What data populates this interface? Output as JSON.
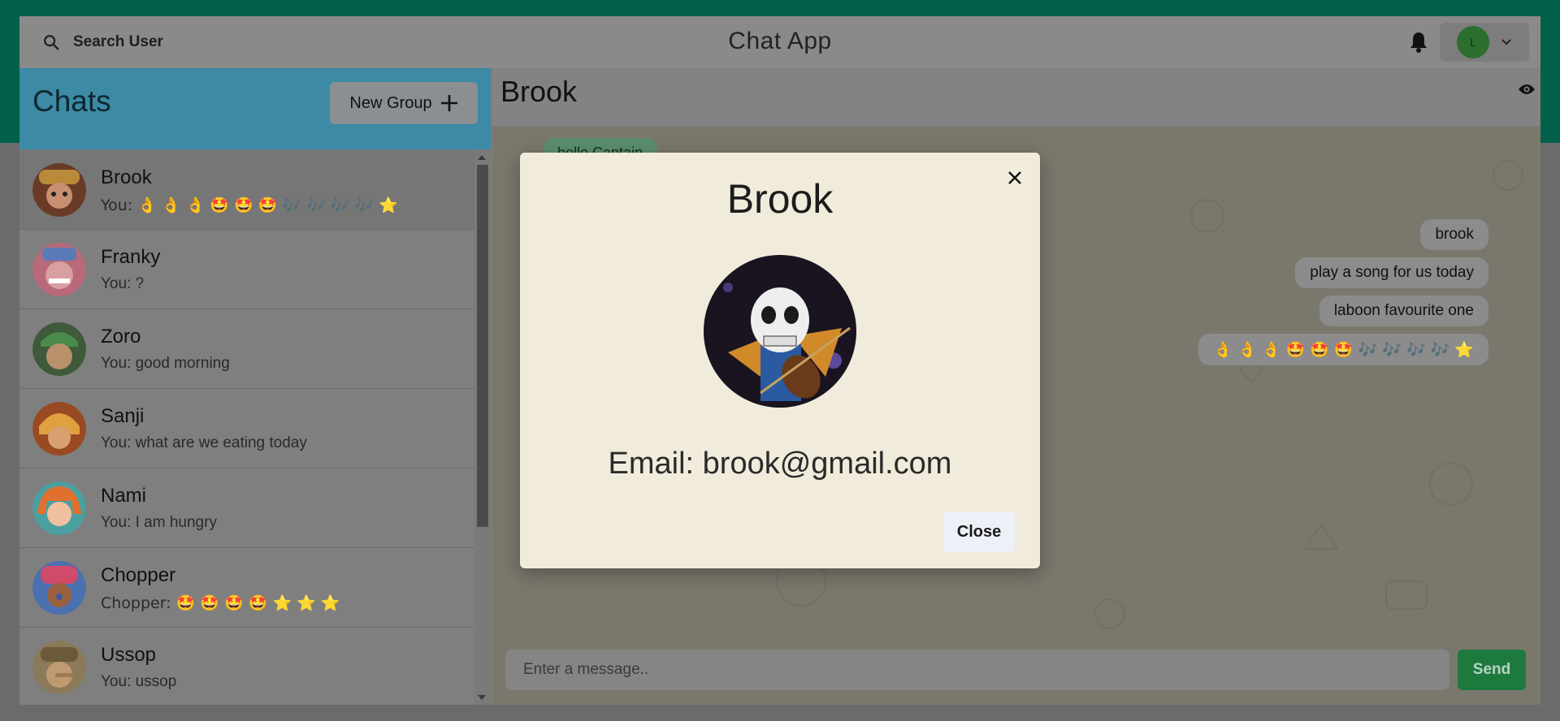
{
  "header": {
    "search_label": "Search User",
    "app_title": "Chat App",
    "user_initial": "L"
  },
  "sidebar": {
    "title": "Chats",
    "new_group_label": "New Group",
    "chats": [
      {
        "name": "Brook",
        "preview": "You: 👌 👌 👌 🤩 🤩 🤩 🎶 🎶 🎶 🎶 ⭐",
        "avatar_color": "#6a3a28",
        "active": true
      },
      {
        "name": "Franky",
        "preview": "You: ?",
        "avatar_color": "#b86a7a"
      },
      {
        "name": "Zoro",
        "preview": "You: good morning",
        "avatar_color": "#3e5a3a"
      },
      {
        "name": "Sanji",
        "preview": "You: what are we eating today",
        "avatar_color": "#9a4a22"
      },
      {
        "name": "Nami",
        "preview": "You: I am hungry",
        "avatar_color": "#c86a3a"
      },
      {
        "name": "Chopper",
        "preview": "Chopper: 🤩 🤩 🤩 🤩 ⭐ ⭐ ⭐",
        "avatar_color": "#7a4a3a"
      },
      {
        "name": "Ussop",
        "preview": "You: ussop",
        "avatar_color": "#8a7a5a"
      }
    ]
  },
  "chat": {
    "name": "Brook",
    "incoming": [
      {
        "text": "hello Captain"
      }
    ],
    "outgoing": [
      {
        "text": "brook"
      },
      {
        "text": "play a song for us today"
      },
      {
        "text": "laboon favourite one"
      },
      {
        "text": "👌 👌 👌 🤩 🤩 🤩 🎶 🎶 🎶 🎶 ⭐"
      }
    ],
    "input_placeholder": "Enter a message..",
    "send_label": "Send"
  },
  "modal": {
    "title": "Brook",
    "email": "Email: brook@gmail.com",
    "close_label": "Close"
  },
  "colors": {
    "brand": "#00604a",
    "chats_header": "#3c8aa5",
    "send_button": "#1d7a3e",
    "modal_bg": "#f0ebdb"
  }
}
